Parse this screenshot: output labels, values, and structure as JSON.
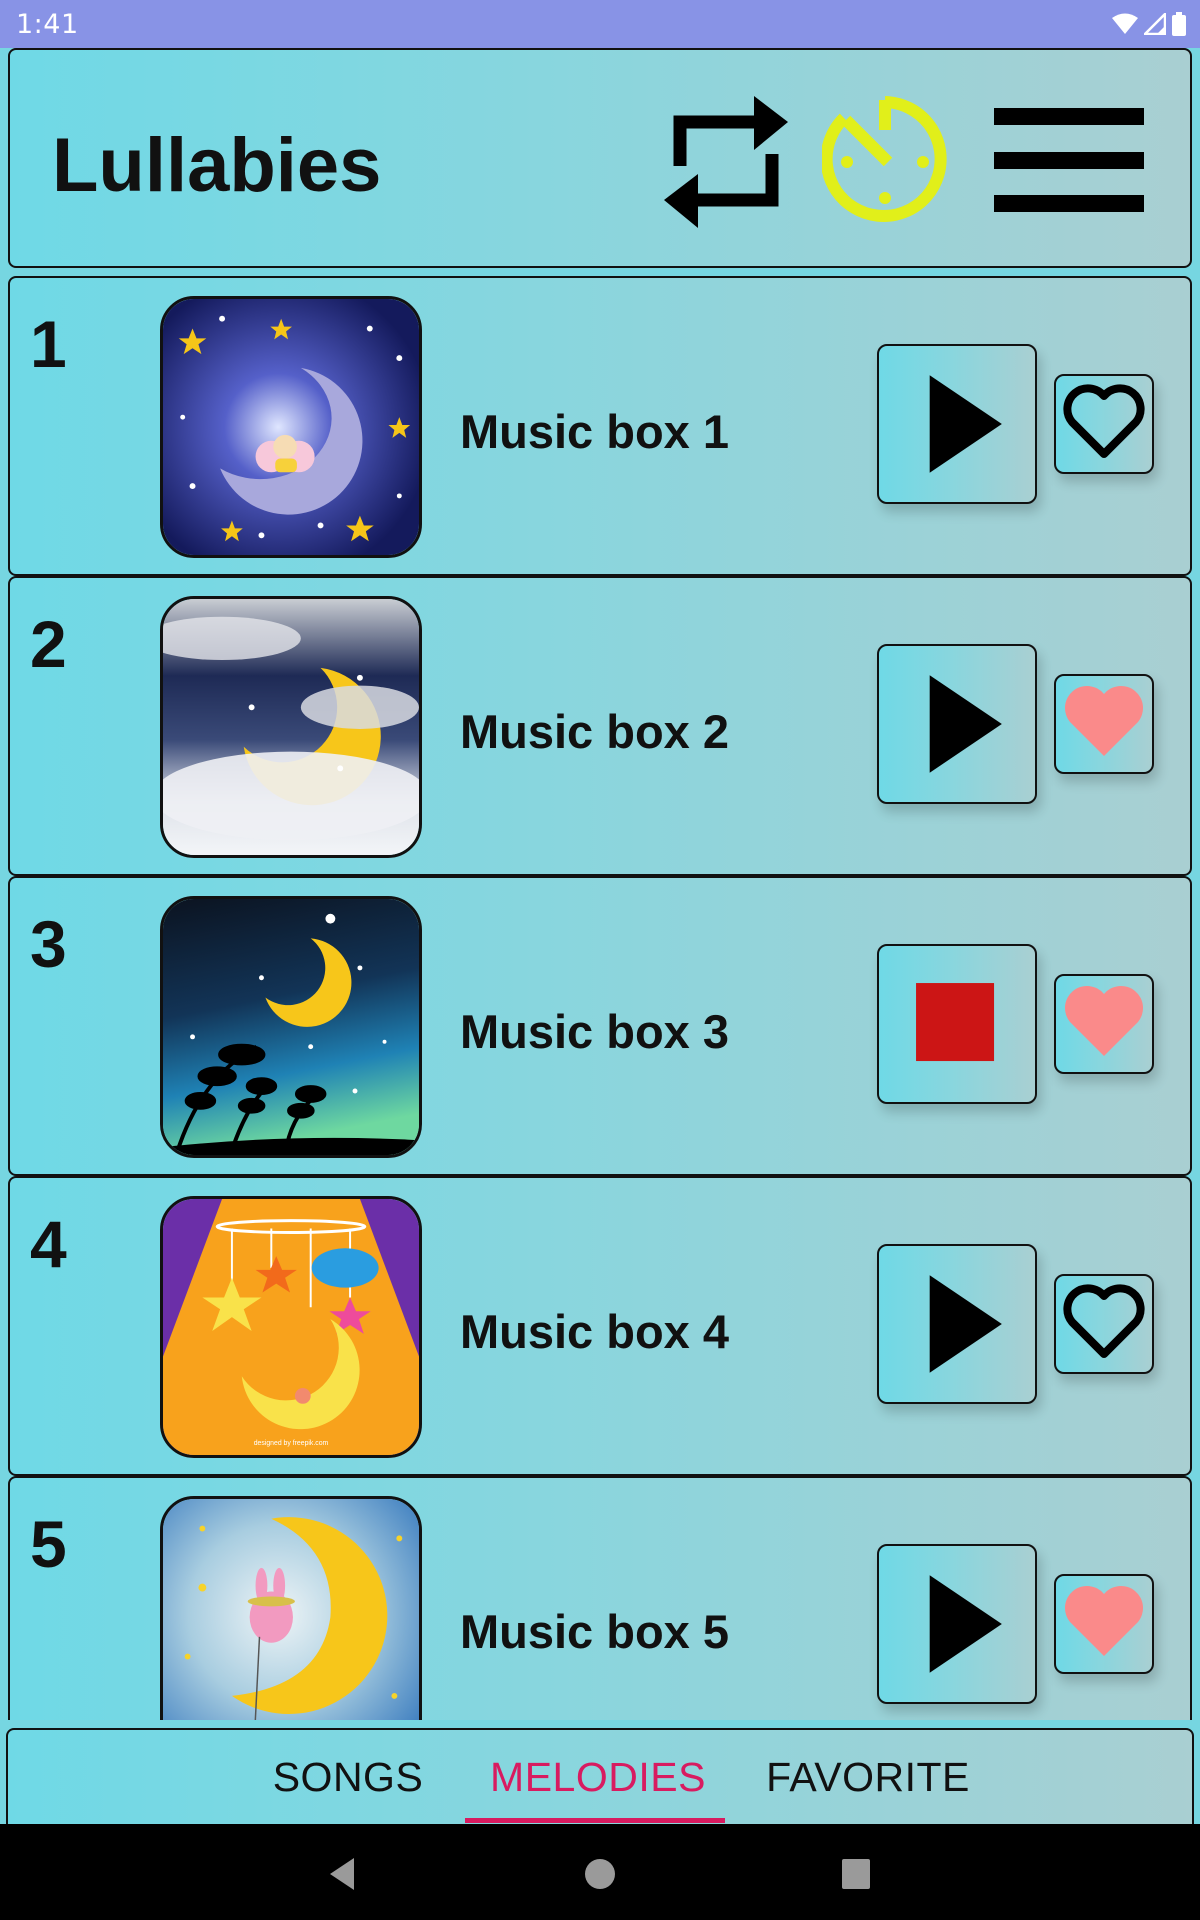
{
  "status_bar": {
    "time": "1:41",
    "icons": [
      "wifi-icon",
      "signal-icon",
      "battery-icon"
    ]
  },
  "header": {
    "title": "Lullabies",
    "actions": [
      {
        "name": "repeat-icon",
        "color": "#000000"
      },
      {
        "name": "sleep-timer-icon",
        "color": "#e1ef1a"
      },
      {
        "name": "menu-icon",
        "color": "#000000"
      }
    ]
  },
  "tracks": [
    {
      "number": "1",
      "title": "Music box 1",
      "thumbnail": "fairy-on-moon",
      "state": "play",
      "favorite": false
    },
    {
      "number": "2",
      "title": "Music box 2",
      "thumbnail": "moon-in-clouds",
      "state": "play",
      "favorite": true
    },
    {
      "number": "3",
      "title": "Music box 3",
      "thumbnail": "moon-night-trees",
      "state": "stop",
      "favorite": true
    },
    {
      "number": "4",
      "title": "Music box 4",
      "thumbnail": "baby-mobile-moon",
      "state": "play",
      "favorite": false,
      "thumbnail_credit": "designed by freepik.com"
    },
    {
      "number": "5",
      "title": "Music box 5",
      "thumbnail": "bunny-on-moon",
      "state": "play",
      "favorite": true
    }
  ],
  "tabs": [
    {
      "label": "SONGS",
      "active": false
    },
    {
      "label": "MELODIES",
      "active": true
    },
    {
      "label": "FAVORITE",
      "active": false
    }
  ],
  "colors": {
    "status_bar": "#8893e6",
    "accent_tab": "#d81b60",
    "stop": "#cc1515",
    "heart_filled": "#fa8a8a",
    "timer": "#e1ef1a"
  },
  "nav": [
    "back-button",
    "home-button",
    "recents-button"
  ]
}
